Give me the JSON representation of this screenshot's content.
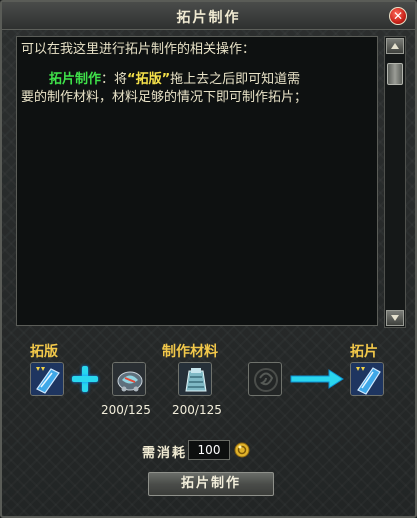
{
  "window": {
    "title": "拓片制作",
    "close_label": "✕"
  },
  "description": {
    "line1": "可以在我这里进行拓片制作的相关操作：",
    "line2_highlight": "拓片制作",
    "line2_mid": "：将",
    "line2_item": "“拓版”",
    "line2_rest": "拖上去之后即可知道需",
    "line3": "要的制作材料，材料足够的情况下即可制作拓片；"
  },
  "crafting": {
    "rubbing_plate_label": "拓版",
    "materials_label": "制作材料",
    "result_label": "拓片",
    "material_1_count": "200/125",
    "material_2_count": "200/125"
  },
  "cost": {
    "label": "需消耗",
    "value": "100"
  },
  "buttons": {
    "make": "拓片制作"
  },
  "colors": {
    "gold_label": "#f2c84a",
    "highlight_green": "#3fe24a",
    "highlight_yellow": "#f6e24a",
    "plus_cyan": "#29d7ef",
    "close_red": "#c8231a"
  },
  "icons": {
    "close": "close-icon",
    "plus": "plus-icon",
    "arrow": "right-arrow-icon",
    "coin": "coin-icon",
    "scroll_up": "scroll-up-icon",
    "scroll_down": "scroll-down-icon"
  }
}
